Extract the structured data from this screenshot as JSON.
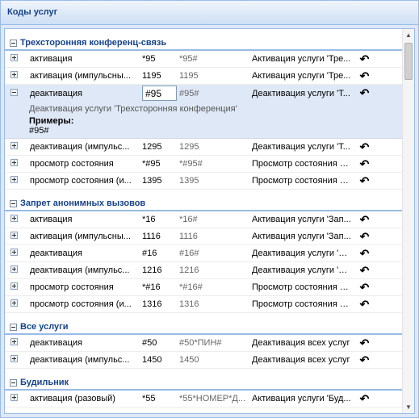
{
  "panel_title": "Коды услуг",
  "action_icon": "undo-arrow-icon",
  "groups": [
    {
      "title": "Трехсторонняя конференц-связь",
      "rows": [
        {
          "name": "активация",
          "code": "*95",
          "full": "*95#",
          "desc": "Активация услуги 'Тре..."
        },
        {
          "name": "активация (импульсны...",
          "code": "1195",
          "full": "1195",
          "desc": "Активация услуги 'Тре..."
        },
        {
          "name": "деактивация",
          "code": "#95",
          "full": "#95#",
          "desc": "Деактивация услуги 'Т..."
        },
        {
          "name": "деактивация (импульс...",
          "code": "1295",
          "full": "1295",
          "desc": "Деактивация услуги 'Т..."
        },
        {
          "name": "просмотр состояния",
          "code": "*#95",
          "full": "*#95#",
          "desc": "Просмотр состояния усл..."
        },
        {
          "name": "просмотр состояния (и...",
          "code": "1395",
          "full": "1395",
          "desc": "Просмотр состояния усл..."
        }
      ],
      "expanded": {
        "full_desc": "Деактивация услуги 'Трехсторонняя конференция'",
        "examples_label": "Примеры:",
        "example": "#95#"
      }
    },
    {
      "title": "Запрет анонимных вызовов",
      "rows": [
        {
          "name": "активация",
          "code": "*16",
          "full": "*16#",
          "desc": "Активация услуги 'Зап..."
        },
        {
          "name": "активация (импульсны...",
          "code": "1116",
          "full": "1116",
          "desc": "Активация услуги 'Зап..."
        },
        {
          "name": "деактивация",
          "code": "#16",
          "full": "#16#",
          "desc": "Деактивация услуги 'З..."
        },
        {
          "name": "деактивация (импульс...",
          "code": "1216",
          "full": "1216",
          "desc": "Деактивация услуги 'З..."
        },
        {
          "name": "просмотр состояния",
          "code": "*#16",
          "full": "*#16#",
          "desc": "Просмотр состояния усл..."
        },
        {
          "name": "просмотр состояния (и...",
          "code": "1316",
          "full": "1316",
          "desc": "Просмотр состояния усл..."
        }
      ]
    },
    {
      "title": "Все услуги",
      "rows": [
        {
          "name": "деактивация",
          "code": "#50",
          "full": "#50*ПИН#",
          "desc": "Деактивация всех услуг"
        },
        {
          "name": "деактивация (импульс...",
          "code": "1450",
          "full": "1450",
          "desc": "Деактивация всех услуг"
        }
      ]
    },
    {
      "title": "Будильник",
      "rows": [
        {
          "name": "активация (разовый)",
          "code": "*55",
          "full": "*55*НОМЕР*Д...",
          "desc": "Активация услуги 'Буд..."
        }
      ]
    }
  ]
}
